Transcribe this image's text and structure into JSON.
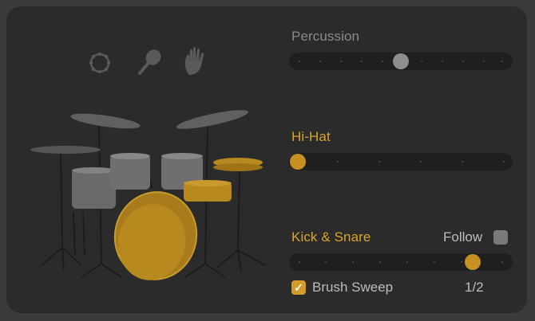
{
  "percussion": {
    "label": "Percussion",
    "value": 0.5,
    "icons": [
      "tambourine-icon",
      "maraca-icon",
      "hand-clap-icon"
    ]
  },
  "hihat": {
    "label": "Hi-Hat",
    "value": 0.0
  },
  "kick_snare": {
    "label": "Kick & Snare",
    "value": 0.85,
    "follow_label": "Follow",
    "follow_checked": false,
    "brush_sweep_label": "Brush Sweep",
    "brush_sweep_checked": true,
    "brush_sweep_check_glyph": "✓",
    "brush_sweep_value": "1/2"
  },
  "colors": {
    "accent": "#d9a42b",
    "inactive": "#8a8a8a",
    "panel": "#2b2b2b"
  }
}
